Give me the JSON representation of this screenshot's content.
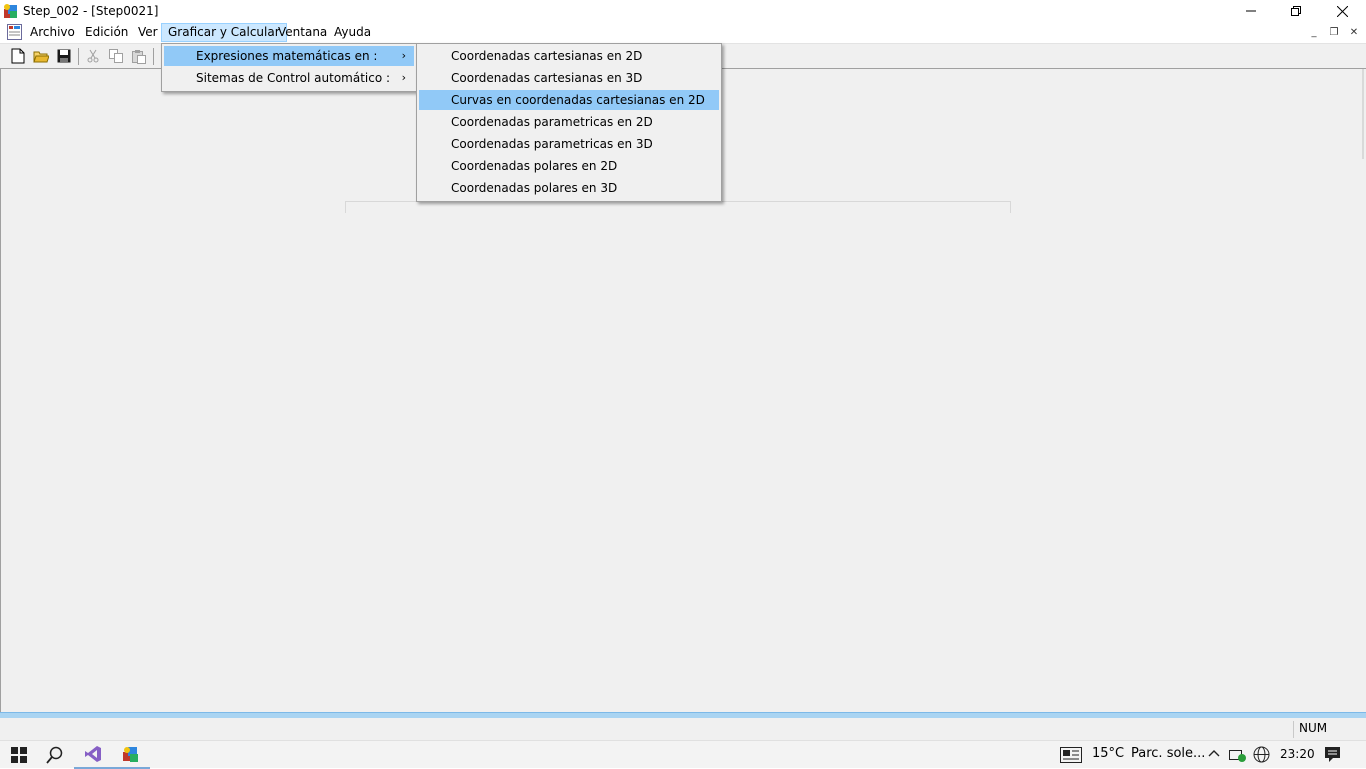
{
  "window": {
    "title": "Step_002 - [Step0021]"
  },
  "menubar": {
    "items": [
      {
        "label": "Archivo"
      },
      {
        "label": "Edición"
      },
      {
        "label": "Ver"
      },
      {
        "label": "Graficar y Calcular",
        "active": true
      },
      {
        "label": "Ventana"
      },
      {
        "label": "Ayuda"
      }
    ]
  },
  "toolbar": {
    "buttons": [
      "new-file-icon",
      "open-folder-icon",
      "save-icon",
      "cut-icon",
      "copy-icon",
      "paste-icon"
    ]
  },
  "graficar_menu": {
    "items": [
      {
        "label": "Expresiones matemáticas en :",
        "submenu": true,
        "highlighted": true
      },
      {
        "label": "Sitemas de Control automático :",
        "submenu": true,
        "highlighted": false
      }
    ]
  },
  "expresiones_submenu": {
    "items": [
      {
        "label": "Coordenadas cartesianas en 2D"
      },
      {
        "label": "Coordenadas cartesianas en 3D"
      },
      {
        "label": "Curvas en coordenadas cartesianas en 2D",
        "highlighted": true
      },
      {
        "label": "Coordenadas parametricas en 2D"
      },
      {
        "label": "Coordenadas parametricas en 3D"
      },
      {
        "label": "Coordenadas polares en 2D"
      },
      {
        "label": "Coordenadas polares en 3D"
      }
    ]
  },
  "statusbar": {
    "num": "NUM"
  },
  "taskbar": {
    "weather_temp": "15°C",
    "weather_text": "Parc. sole...",
    "clock": "23:20"
  },
  "colors": {
    "menu_highlight": "#91c9f7",
    "menubar_active": "#cce8ff",
    "client_bg": "#f0f0f0"
  }
}
